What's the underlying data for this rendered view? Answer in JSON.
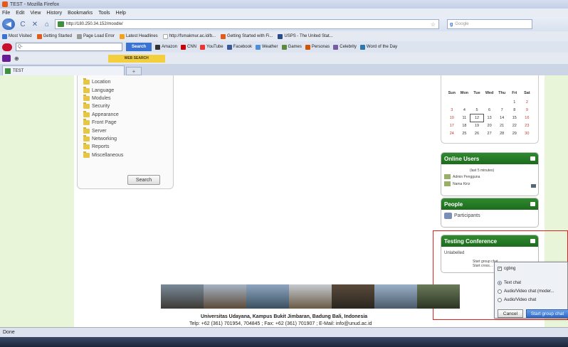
{
  "window": {
    "title": "TEST - Mozilla Firefox"
  },
  "menu": [
    "File",
    "Edit",
    "View",
    "History",
    "Bookmarks",
    "Tools",
    "Help"
  ],
  "nav": {
    "url": "http://180.250.34.152/moodle/",
    "search_placeholder": "Google"
  },
  "bookmarks": [
    {
      "label": "Most Visited",
      "color": "#3b73d3"
    },
    {
      "label": "Getting Started",
      "color": "#e25b1a"
    },
    {
      "label": "Page Load Error",
      "color": "#999999"
    },
    {
      "label": "Latest Headlines",
      "color": "#f3a21d"
    },
    {
      "label": "http://fsmakmur.ac.id/b...",
      "color": "#ffffff"
    },
    {
      "label": "Getting Started with Fi...",
      "color": "#e25b1a"
    },
    {
      "label": "USPS - The United Stat...",
      "color": "#2b4a8a"
    }
  ],
  "toolbar1": {
    "search_value": "Q-",
    "search_button": "Search",
    "items": [
      "Amazon",
      "CNN",
      "YouTube",
      "Facebook",
      "Weather",
      "Games",
      "Personas",
      "Celebrity",
      "Word of the Day"
    ]
  },
  "toolbar2": {
    "web_search_button": "WEB SEARCH"
  },
  "tab": {
    "title": "TEST",
    "new_tab": "+"
  },
  "categories": [
    "Location",
    "Language",
    "Modules",
    "Security",
    "Appearance",
    "Front Page",
    "Server",
    "Networking",
    "Reports",
    "Miscellaneous"
  ],
  "cat_search_button": "Search",
  "calendar": {
    "headers": [
      "Sun",
      "Mon",
      "Tue",
      "Wed",
      "Thu",
      "Fri",
      "Sat"
    ],
    "rows": [
      [
        "",
        "",
        "",
        "",
        "",
        "1",
        "2"
      ],
      [
        "3",
        "4",
        "5",
        "6",
        "7",
        "8",
        "9"
      ],
      [
        "10",
        "11",
        "12",
        "13",
        "14",
        "15",
        "16"
      ],
      [
        "17",
        "18",
        "19",
        "20",
        "21",
        "22",
        "23"
      ],
      [
        "24",
        "25",
        "26",
        "27",
        "28",
        "29",
        "30"
      ]
    ],
    "today": "12"
  },
  "online_users": {
    "title": "Online Users",
    "note": "(last 5 minutes)",
    "users": [
      "Admin Pengguna",
      "Nama Kiriz"
    ]
  },
  "people": {
    "title": "People",
    "participants": "Participants"
  },
  "testing_conf": {
    "title": "Testing Conference",
    "unlabelled": "Unlabelled",
    "chat1": "Start group chat",
    "chat2": "Start cross..."
  },
  "popup": {
    "option_check": "cgbng",
    "options": [
      "Text chat",
      "Audio/Video chat (moder...",
      "Audio/Video chat"
    ],
    "cancel": "Cancel",
    "start": "Start group chat"
  },
  "footer": {
    "line1": "Universitas Udayana, Kampus Bukit Jimbaran, Badung Bali, Indonesia",
    "line2": "Telp: +62 (361) 701954, 704845 ; Fax: +62 (361) 701907 ; E-Mail: info@unud.ac.id"
  },
  "status": "Done"
}
